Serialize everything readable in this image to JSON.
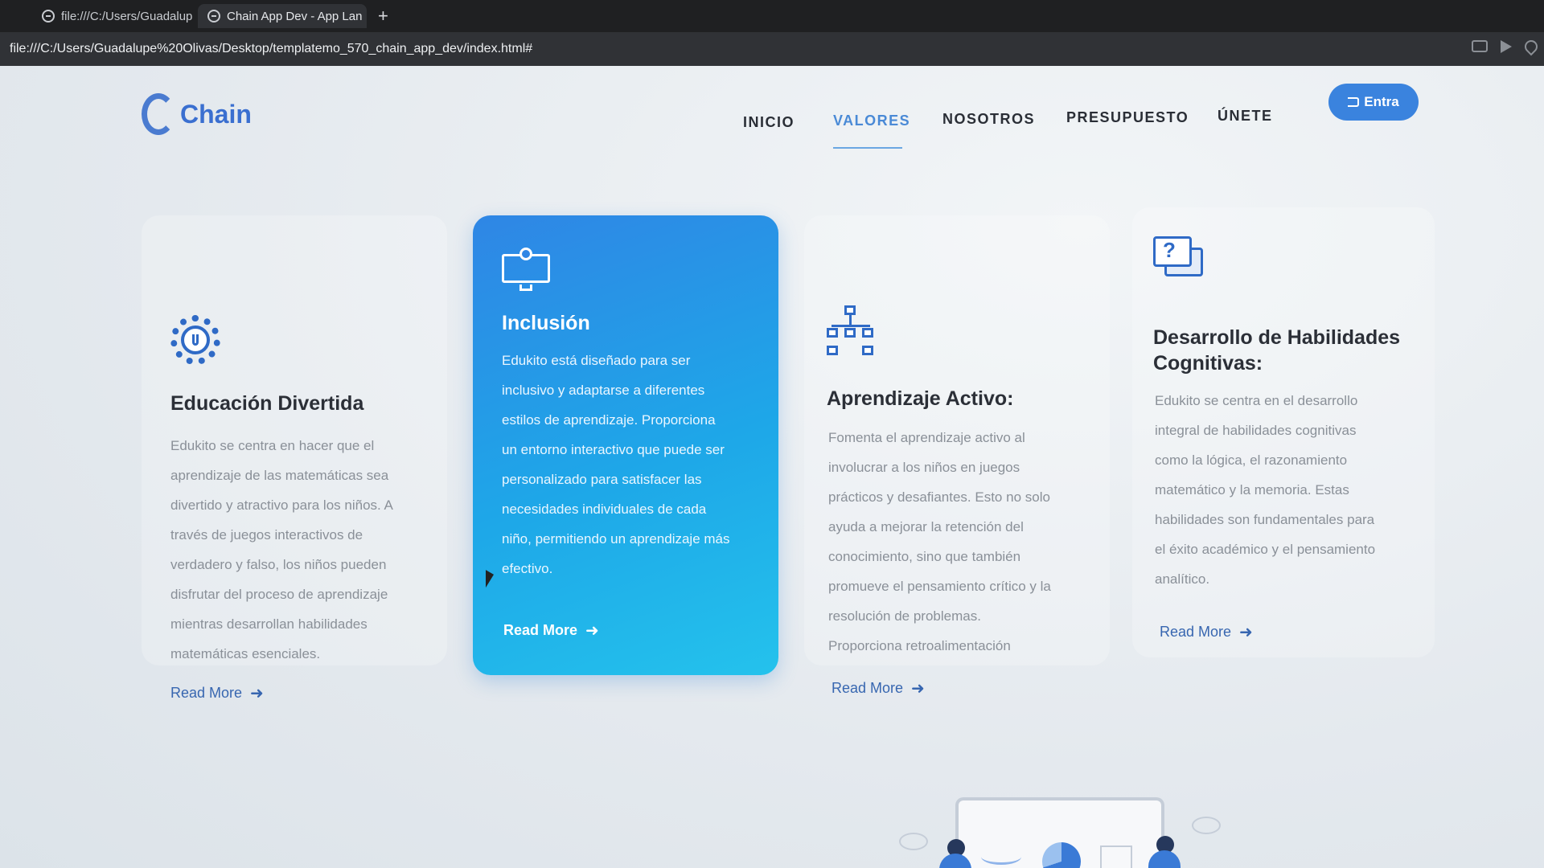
{
  "browser": {
    "tabs": [
      {
        "label": "file:///C:/Users/Guadalup"
      },
      {
        "label": "Chain App Dev - App Lan"
      }
    ],
    "new_tab": "+",
    "url": "file:///C:/Users/Guadalupe%20Olivas/Desktop/templatemo_570_chain_app_dev/index.html#"
  },
  "header": {
    "logo_text": "Chain",
    "nav": [
      "INICIO",
      "VALORES",
      "NOSOTROS",
      "PRESUPUESTO",
      "ÚNETE"
    ],
    "active_nav": "VALORES",
    "login_label": "Entra"
  },
  "cards": [
    {
      "icon": "gear-icon",
      "title": "Educación Divertida",
      "lines": [
        "Edukito se centra en hacer que el",
        "aprendizaje de las matemáticas sea",
        "divertido y atractivo para los niños. A",
        "través de juegos interactivos de",
        "verdadero y falso, los niños pueden",
        "disfrutar del proceso de aprendizaje",
        "mientras desarrollan habilidades",
        "matemáticas esenciales."
      ],
      "read_more": "Read More"
    },
    {
      "icon": "monitor-person-icon",
      "title": "Inclusión",
      "lines": [
        "Edukito está diseñado para ser",
        "inclusivo y adaptarse a diferentes",
        "estilos de aprendizaje. Proporciona",
        "un entorno interactivo que puede ser",
        "personalizado para satisfacer las",
        "necesidades individuales de cada",
        "niño, permitiendo un aprendizaje más",
        "efectivo."
      ],
      "read_more": "Read More"
    },
    {
      "icon": "hierarchy-icon",
      "title": "Aprendizaje Activo:",
      "lines": [
        "Fomenta el aprendizaje activo al",
        "involucrar a los niños en juegos",
        "prácticos y desafiantes. Esto no solo",
        "ayuda a mejorar la retención del",
        "conocimiento, sino que también",
        "promueve el pensamiento crítico y la",
        "resolución de problemas.",
        "Proporciona retroalimentación"
      ],
      "read_more": "Read More"
    },
    {
      "icon": "chat-question-icon",
      "title_lines": [
        "Desarrollo de Habilidades",
        "Cognitivas:"
      ],
      "lines": [
        "Edukito se centra en el desarrollo",
        "integral de habilidades cognitivas",
        "como la lógica, el razonamiento",
        "matemático y la memoria. Estas",
        "habilidades son fundamentales para",
        "el éxito académico y el pensamiento",
        "analítico."
      ],
      "read_more": "Read More"
    }
  ],
  "colors": {
    "accent": "#3a83de",
    "active_nav": "#4a8ad6",
    "card_highlight_start": "#2f86e5",
    "card_highlight_end": "#24c2ec"
  }
}
